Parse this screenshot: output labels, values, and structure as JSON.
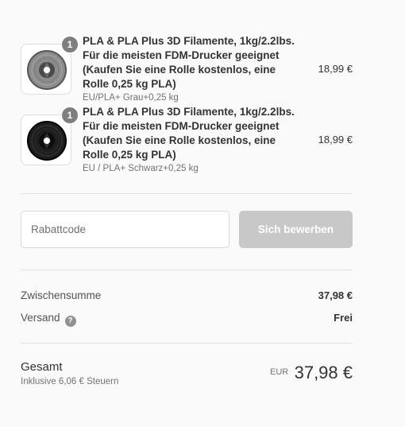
{
  "cart": {
    "items": [
      {
        "quantity": "1",
        "title": "PLA & PLA Plus 3D Filamente, 1kg/2.2lbs. Für die meisten FDM-Drucker geeignet (Kaufen Sie eine Rolle kostenlos, eine Rolle 0,25 kg PLA)",
        "variant": "EU/PLA+ Grau+0,25 kg",
        "price": "18,99 €",
        "image_icon": "grey-filament-spool-icon",
        "spool_color": "#8c8c8c"
      },
      {
        "quantity": "1",
        "title": "PLA & PLA Plus 3D Filamente, 1kg/2.2lbs. Für die meisten FDM-Drucker geeignet (Kaufen Sie eine Rolle kostenlos, eine Rolle 0,25 kg PLA)",
        "variant": "EU / PLA+ Schwarz+0,25 kg",
        "price": "18,99 €",
        "image_icon": "black-filament-spool-icon",
        "spool_color": "#1e1e1e"
      }
    ]
  },
  "discount": {
    "placeholder": "Rabattcode",
    "value": "",
    "apply_label": "Sich bewerben"
  },
  "summary": {
    "subtotal_label": "Zwischensumme",
    "subtotal_value": "37,98 €",
    "shipping_label": "Versand",
    "shipping_help_icon": "question-circle-icon",
    "shipping_value": "Frei",
    "total_label": "Gesamt",
    "tax_note": "Inklusive 6,06 € Steuern",
    "currency": "EUR",
    "total_value": "37,98 €"
  },
  "colors": {
    "background": "#fafafa",
    "badge": "#7f7f7f",
    "button_disabled": "#c8c8c8",
    "divider": "#e1e1e1"
  }
}
